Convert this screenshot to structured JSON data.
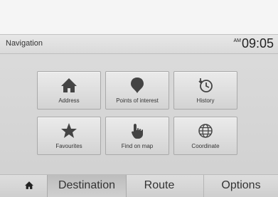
{
  "header": {
    "title": "Navigation",
    "clock_prefix": "AM",
    "time": "09:05"
  },
  "tiles": [
    {
      "label": "Address",
      "icon": "home-icon"
    },
    {
      "label": "Points of interest",
      "icon": "map-pin-icon"
    },
    {
      "label": "History",
      "icon": "history-icon"
    },
    {
      "label": "Favourites",
      "icon": "star-icon"
    },
    {
      "label": "Find on map",
      "icon": "pointer-hand-icon"
    },
    {
      "label": "Coordinate",
      "icon": "globe-icon"
    }
  ],
  "tabs": {
    "home_icon": "home-icon",
    "destination": "Destination",
    "route": "Route",
    "options": "Options",
    "active": "Destination"
  }
}
